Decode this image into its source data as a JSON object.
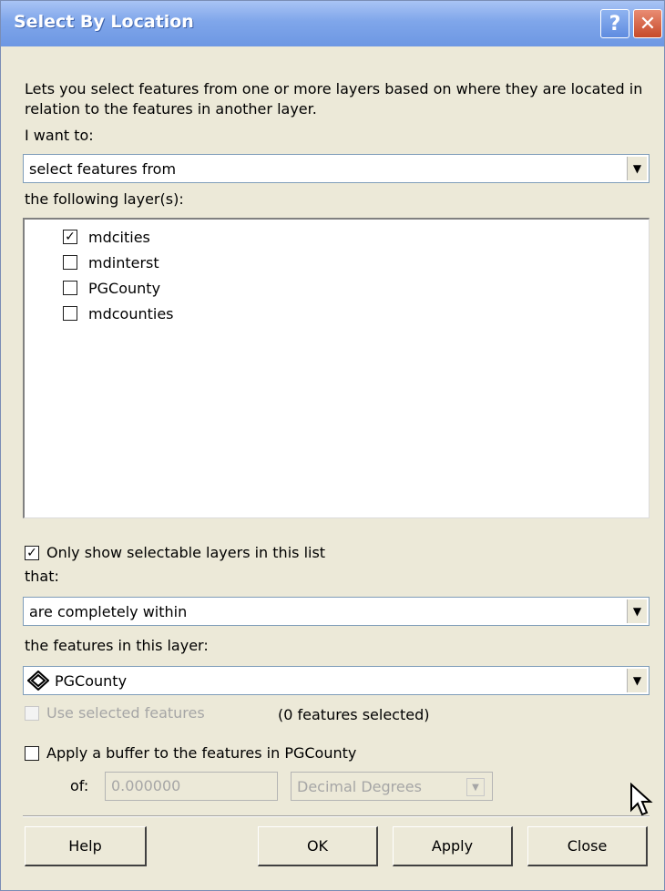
{
  "window": {
    "title": "Select By Location",
    "help_icon": "?",
    "close_icon": "✕"
  },
  "description": "Lets you select features from one or more layers based on where they are located in relation to the features in another layer.",
  "method": {
    "label": "I want to:",
    "value": "select features from"
  },
  "layers": {
    "label": "the following layer(s):",
    "items": [
      {
        "name": "mdcities",
        "checked": true
      },
      {
        "name": "mdinterst",
        "checked": false
      },
      {
        "name": "PGCounty",
        "checked": false
      },
      {
        "name": "mdcounties",
        "checked": false
      }
    ]
  },
  "only_selectable": {
    "label": "Only show selectable layers in this list",
    "checked": true
  },
  "relation": {
    "label": "that:",
    "value": "are completely within"
  },
  "source": {
    "label": "the features in this layer:",
    "value": "PGCounty",
    "icon": "polygon-layer-icon"
  },
  "use_selected": {
    "label": "Use selected features",
    "count_text": "(0 features selected)",
    "checked": false,
    "enabled": false
  },
  "buffer": {
    "label": "Apply a buffer to the features in PGCounty",
    "checked": false,
    "of_label": "of:",
    "distance": "0.000000",
    "units": "Decimal Degrees"
  },
  "buttons": {
    "help": "Help",
    "ok": "OK",
    "apply": "Apply",
    "close": "Close"
  }
}
